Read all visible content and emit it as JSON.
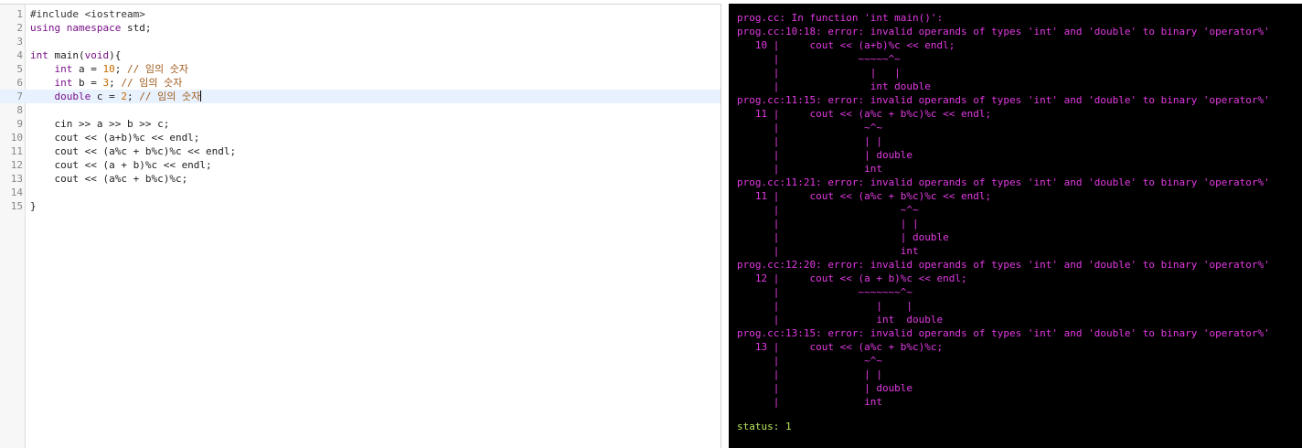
{
  "editor": {
    "active_line": 7,
    "lines": [
      {
        "n": "1",
        "tokens": [
          {
            "t": "#include <iostream>",
            "c": "pre"
          }
        ]
      },
      {
        "n": "2",
        "tokens": [
          {
            "t": "using ",
            "c": "kw"
          },
          {
            "t": "namespace ",
            "c": "kw"
          },
          {
            "t": "std;",
            "c": "plain"
          }
        ]
      },
      {
        "n": "3",
        "tokens": []
      },
      {
        "n": "4",
        "tokens": [
          {
            "t": "int ",
            "c": "type"
          },
          {
            "t": "main(",
            "c": "plain"
          },
          {
            "t": "void",
            "c": "type"
          },
          {
            "t": "){",
            "c": "plain"
          }
        ]
      },
      {
        "n": "5",
        "tokens": [
          {
            "t": "    ",
            "c": "plain"
          },
          {
            "t": "int ",
            "c": "type"
          },
          {
            "t": "a = ",
            "c": "plain"
          },
          {
            "t": "10",
            "c": "num"
          },
          {
            "t": "; ",
            "c": "plain"
          },
          {
            "t": "// 임의 숫자",
            "c": "com"
          }
        ]
      },
      {
        "n": "6",
        "tokens": [
          {
            "t": "    ",
            "c": "plain"
          },
          {
            "t": "int ",
            "c": "type"
          },
          {
            "t": "b = ",
            "c": "plain"
          },
          {
            "t": "3",
            "c": "num"
          },
          {
            "t": "; ",
            "c": "plain"
          },
          {
            "t": "// 임의 숫자",
            "c": "com"
          }
        ]
      },
      {
        "n": "7",
        "tokens": [
          {
            "t": "    ",
            "c": "plain"
          },
          {
            "t": "double ",
            "c": "type"
          },
          {
            "t": "c = ",
            "c": "plain"
          },
          {
            "t": "2",
            "c": "num"
          },
          {
            "t": "; ",
            "c": "plain"
          },
          {
            "t": "// 임의 숫자",
            "c": "com"
          }
        ],
        "cursor": true
      },
      {
        "n": "8",
        "tokens": []
      },
      {
        "n": "9",
        "tokens": [
          {
            "t": "    cin >> a >> b >> c;",
            "c": "plain"
          }
        ]
      },
      {
        "n": "10",
        "tokens": [
          {
            "t": "    cout << (a+b)%c << endl;",
            "c": "plain"
          }
        ]
      },
      {
        "n": "11",
        "tokens": [
          {
            "t": "    cout << (a%c + b%c)%c << endl;",
            "c": "plain"
          }
        ]
      },
      {
        "n": "12",
        "tokens": [
          {
            "t": "    cout << (a + b)%c << endl;",
            "c": "plain"
          }
        ]
      },
      {
        "n": "13",
        "tokens": [
          {
            "t": "    cout << (a%c + b%c)%c;",
            "c": "plain"
          }
        ]
      },
      {
        "n": "14",
        "tokens": []
      },
      {
        "n": "15",
        "tokens": [
          {
            "t": "}",
            "c": "plain"
          }
        ]
      }
    ]
  },
  "terminal": {
    "lines": [
      "prog.cc: In function 'int main()':",
      "prog.cc:10:18: error: invalid operands of types 'int' and 'double' to binary 'operator%'",
      "   10 |     cout << (a+b)%c << endl;",
      "      |             ~~~~~^~",
      "      |               |   |",
      "      |               int double",
      "prog.cc:11:15: error: invalid operands of types 'int' and 'double' to binary 'operator%'",
      "   11 |     cout << (a%c + b%c)%c << endl;",
      "      |              ~^~",
      "      |              | |",
      "      |              | double",
      "      |              int",
      "prog.cc:11:21: error: invalid operands of types 'int' and 'double' to binary 'operator%'",
      "   11 |     cout << (a%c + b%c)%c << endl;",
      "      |                    ~^~",
      "      |                    | |",
      "      |                    | double",
      "      |                    int",
      "prog.cc:12:20: error: invalid operands of types 'int' and 'double' to binary 'operator%'",
      "   12 |     cout << (a + b)%c << endl;",
      "      |             ~~~~~~~^~",
      "      |                |    |",
      "      |                int  double",
      "prog.cc:13:15: error: invalid operands of types 'int' and 'double' to binary 'operator%'",
      "   13 |     cout << (a%c + b%c)%c;",
      "      |              ~^~",
      "      |              | |",
      "      |              | double",
      "      |              int"
    ],
    "status": "status: 1"
  }
}
